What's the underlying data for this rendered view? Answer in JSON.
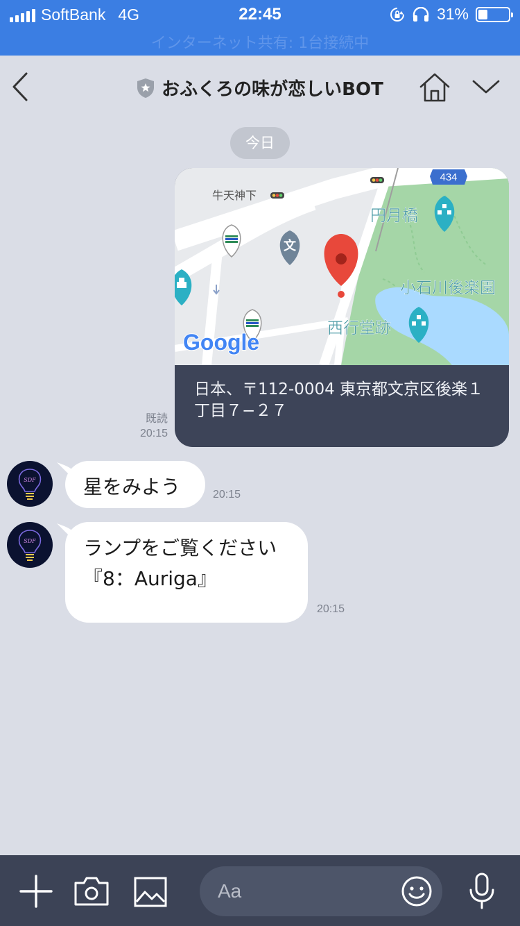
{
  "status_bar": {
    "carrier": "SoftBank",
    "network": "4G",
    "time": "22:45",
    "battery": "31%",
    "battery_level": 0.31,
    "hotspot_text": "インターネット共有: 1台接続中"
  },
  "header": {
    "title": "おふくろの味が恋しいBOT",
    "icons": [
      "back-icon",
      "shield-star-icon",
      "home-icon",
      "chevron-down-icon"
    ]
  },
  "chat": {
    "date_label": "今日",
    "location": {
      "address": "日本、〒112-0004 東京都文京区後楽１丁目７−２７",
      "read_label": "既読",
      "time": "20:15",
      "map_labels": {
        "route_number": "434",
        "place_ushitenjinshita": "牛天神下",
        "place_engetsukyo": "円月橋",
        "place_koishikawa": "小石川後楽園",
        "place_saigyodo": "西行堂跡",
        "school_glyph": "文",
        "google": "Google"
      }
    },
    "messages": [
      {
        "text": "星をみよう",
        "time": "20:15"
      },
      {
        "line1": "ランプをご覧ください",
        "line2": "『8：Auriga』",
        "time": "20:15"
      }
    ],
    "avatar_text": "SDF"
  },
  "input": {
    "placeholder": "Aa",
    "icons": [
      "plus-icon",
      "camera-icon",
      "image-icon",
      "emoji-icon",
      "mic-icon"
    ]
  },
  "colors": {
    "status_bar": "#3b7ee3",
    "chat_bg": "#dadde6",
    "card_bg": "#3d4458",
    "bottom_bar": "#3c4356",
    "map_park": "#a5d6a7",
    "map_water": "#aadaff",
    "pin_red": "#e8483b"
  }
}
